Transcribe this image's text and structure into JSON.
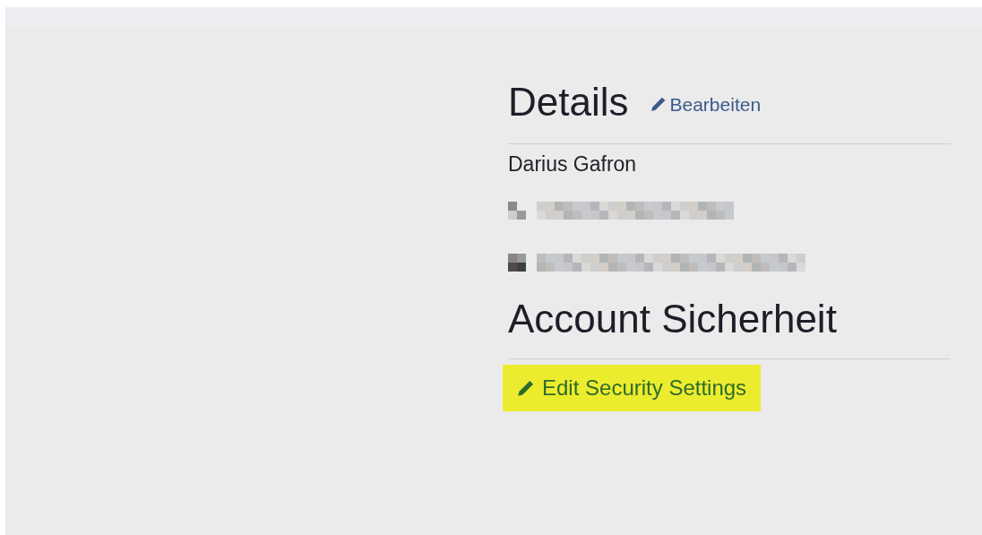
{
  "details": {
    "title": "Details",
    "edit_link": "Bearbeiten",
    "name": "Darius Gafron",
    "redacted_rows": [
      {
        "kind": "phone"
      },
      {
        "kind": "email"
      }
    ]
  },
  "security": {
    "title": "Account Sicherheit",
    "edit_link": {
      "label": "Edit Security Settings",
      "highlighted": true
    }
  }
}
